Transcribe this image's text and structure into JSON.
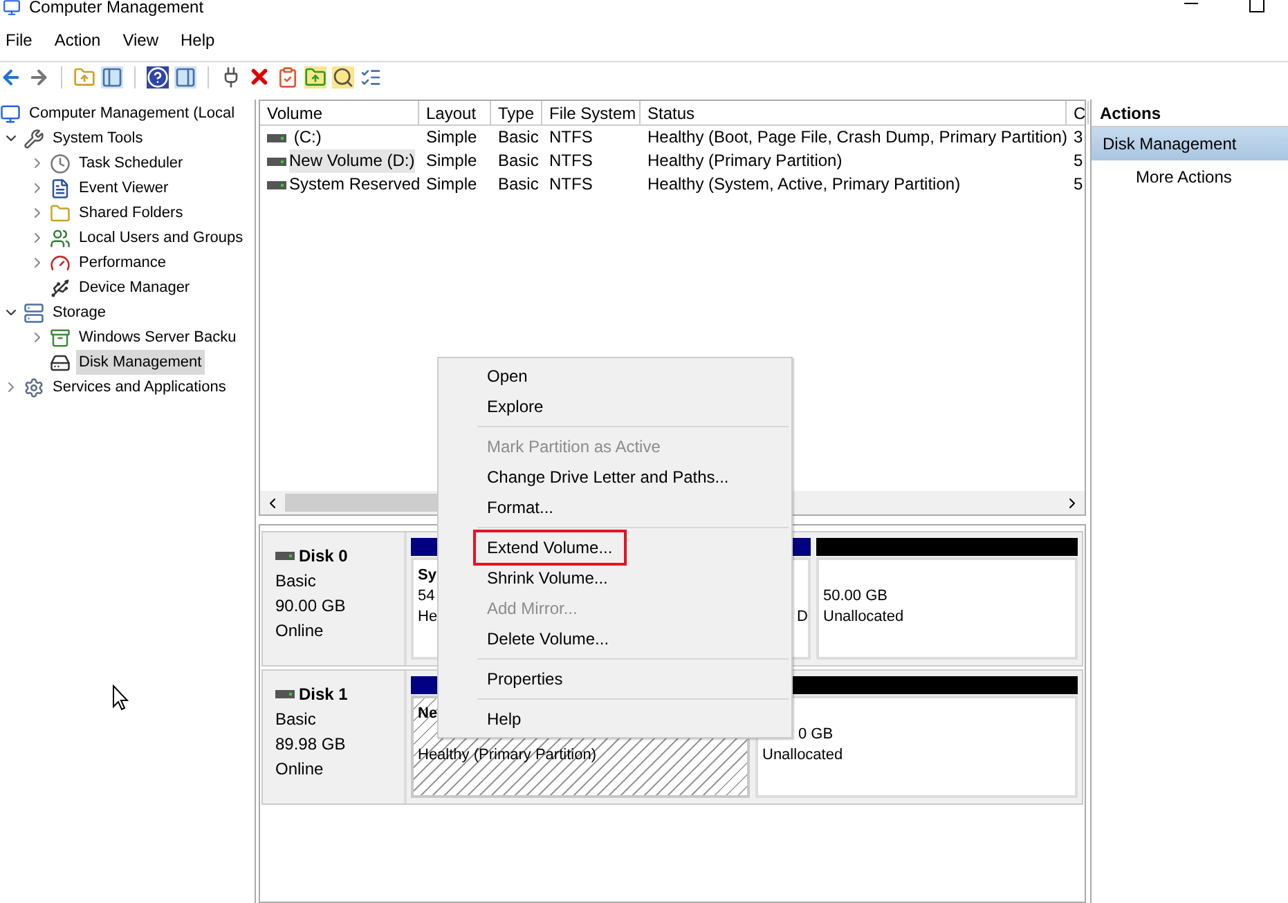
{
  "window": {
    "title": "Computer Management"
  },
  "menu_bar": [
    "File",
    "Action",
    "View",
    "Help"
  ],
  "tree": [
    {
      "label": "Computer Management (Local",
      "selected": false,
      "children": [
        {
          "label": "System Tools",
          "expanded": true,
          "selected": false,
          "children": [
            {
              "label": "Task Scheduler",
              "expanded": false,
              "selected": false
            },
            {
              "label": "Event Viewer",
              "expanded": false,
              "selected": false
            },
            {
              "label": "Shared Folders",
              "expanded": false,
              "selected": false
            },
            {
              "label": "Local Users and Groups",
              "expanded": false,
              "selected": false
            },
            {
              "label": "Performance",
              "expanded": false,
              "selected": false
            },
            {
              "label": "Device Manager",
              "selected": false
            }
          ]
        },
        {
          "label": "Storage",
          "expanded": true,
          "selected": false,
          "children": [
            {
              "label": "Windows Server Backu",
              "expanded": false,
              "selected": false
            },
            {
              "label": "Disk Management",
              "selected": true
            }
          ]
        },
        {
          "label": "Services and Applications",
          "expanded": false,
          "selected": false
        }
      ]
    }
  ],
  "volume_table": {
    "columns": [
      "Volume",
      "Layout",
      "Type",
      "File System",
      "Status",
      "C"
    ],
    "rows": [
      {
        "cells": [
          " (C:)",
          "Simple",
          "Basic",
          "NTFS",
          "Healthy (Boot, Page File, Crash Dump, Primary Partition)",
          "3"
        ],
        "selected": false
      },
      {
        "cells": [
          "New Volume (D:)",
          "Simple",
          "Basic",
          "NTFS",
          "Healthy (Primary Partition)",
          "5"
        ],
        "selected": true
      },
      {
        "cells": [
          "System Reserved",
          "Simple",
          "Basic",
          "NTFS",
          "Healthy (System, Active, Primary Partition)",
          "5"
        ],
        "selected": false
      }
    ]
  },
  "disks": [
    {
      "name": "Disk 0",
      "type": "Basic",
      "size": "90.00 GB",
      "status": "Online",
      "partitions": [
        {
          "kind": "primary",
          "name": "Sy",
          "size": "54",
          "status": "He",
          "selected": false
        },
        {
          "kind": "primary",
          "status": "D",
          "selected": false
        },
        {
          "kind": "unallocated",
          "size": "50.00 GB",
          "status": "Unallocated",
          "selected": false
        }
      ]
    },
    {
      "name": "Disk 1",
      "type": "Basic",
      "size": "89.98 GB",
      "status": "Online",
      "partitions": [
        {
          "kind": "primary",
          "name": "Ne",
          "status": "Healthy (Primary Partition)",
          "selected": true
        },
        {
          "kind": "unallocated",
          "size": "0 GB",
          "status": "Unallocated",
          "selected": false
        }
      ]
    }
  ],
  "context_menu": [
    {
      "kind": "item",
      "label": "Open",
      "disabled": false,
      "marked": false
    },
    {
      "kind": "item",
      "label": "Explore",
      "disabled": false,
      "marked": false
    },
    {
      "kind": "separator"
    },
    {
      "kind": "item",
      "label": "Mark Partition as Active",
      "disabled": true,
      "marked": false
    },
    {
      "kind": "item",
      "label": "Change Drive Letter and Paths...",
      "disabled": false,
      "marked": false
    },
    {
      "kind": "item",
      "label": "Format...",
      "disabled": false,
      "marked": false
    },
    {
      "kind": "separator"
    },
    {
      "kind": "item",
      "label": "Extend Volume...",
      "disabled": false,
      "marked": true
    },
    {
      "kind": "item",
      "label": "Shrink Volume...",
      "disabled": false,
      "marked": false
    },
    {
      "kind": "item",
      "label": "Add Mirror...",
      "disabled": true,
      "marked": false
    },
    {
      "kind": "item",
      "label": "Delete Volume...",
      "disabled": false,
      "marked": false
    },
    {
      "kind": "separator"
    },
    {
      "kind": "item",
      "label": "Properties",
      "disabled": false,
      "marked": false
    },
    {
      "kind": "separator"
    },
    {
      "kind": "item",
      "label": "Help",
      "disabled": false,
      "marked": false
    }
  ],
  "actions": {
    "title": "Actions",
    "items": [
      {
        "label": "Disk Management",
        "kind": "header"
      },
      {
        "label": "More Actions",
        "kind": "action"
      }
    ]
  }
}
